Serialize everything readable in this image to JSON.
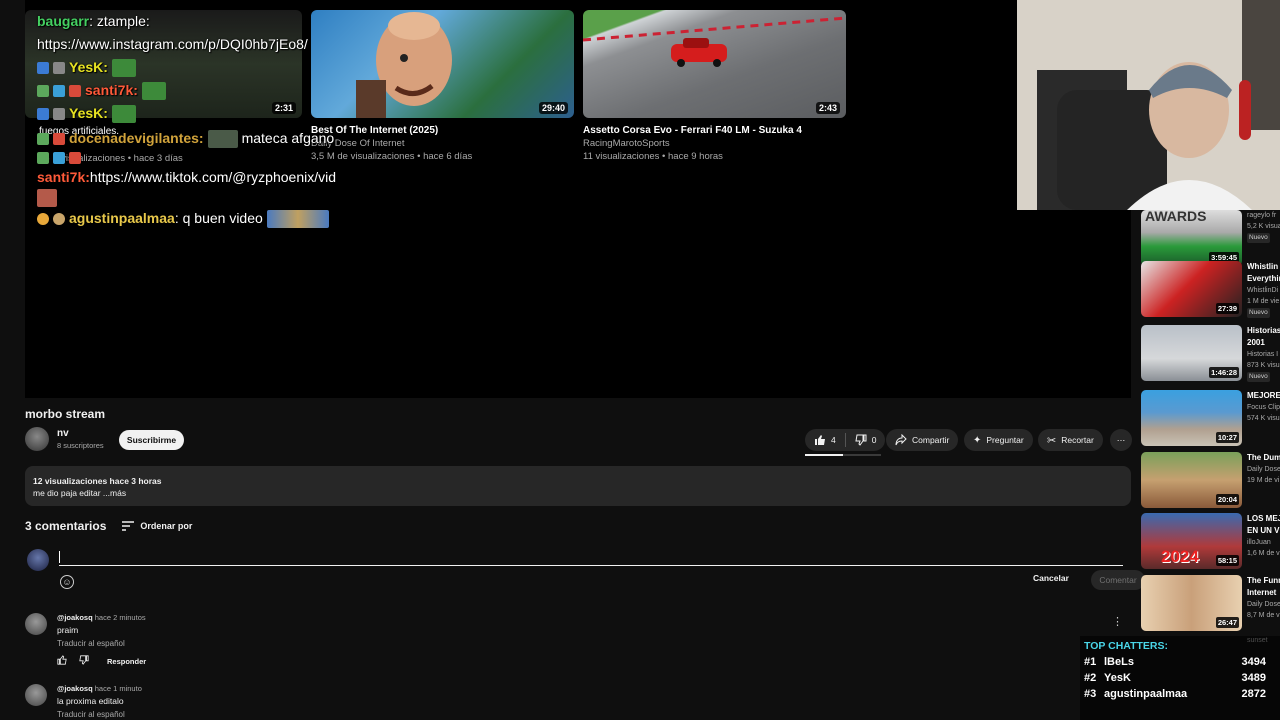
{
  "endscreen": [
    {
      "duration": "2:31",
      "title": "fuegos artificiales.",
      "meta": "36 K visualizaciones • hace 3 días"
    },
    {
      "duration": "29:40",
      "title": "Best Of The Internet (2025)",
      "channel": "Daily Dose Of Internet",
      "meta": "3,5 M de visualizaciones • hace 6 días"
    },
    {
      "duration": "2:43",
      "title": "Assetto Corsa Evo - Ferrari F40 LM - Suzuka 4",
      "channel": "RacingMarotoSports",
      "meta": "11 visualizaciones • hace 9 horas"
    }
  ],
  "chat": {
    "m1_user": "baugarr",
    "m1_text": ": ztample:",
    "m1_link": "https://www.instagram.com/p/DQI0hb7jEo8/",
    "m2_user": "YesK:",
    "m3_user": "santi7k:",
    "m4_user": "YesK:",
    "m5_user": "docenadevigilantes:",
    "m5_text": "mateca afgano",
    "m6_user": "santi7k:",
    "m6_text": " https://www.tiktok.com/@ryzphoenix/vid",
    "m7_user": "agustinpaalmaa",
    "m7_text": ": q buen video"
  },
  "video": {
    "title": "morbo stream",
    "channel_name": "nv",
    "subscribers": "8 suscriptores",
    "subscribe_label": "Suscribirme",
    "likes": "4",
    "dislikes": "0",
    "share_label": "Compartir",
    "ask_label": "Preguntar",
    "clip_label": "Recortar",
    "more_icon": "⋯",
    "stats": "12 visualizaciones  hace 3 horas",
    "description": "me dio paja editar ...más"
  },
  "comments": {
    "count_label": "3 comentarios",
    "sort_label": "Ordenar por",
    "cancel_label": "Cancelar",
    "comment_label": "Comentar",
    "items": [
      {
        "author": "@joakosq",
        "time": "hace 2 minutos",
        "text": "praim",
        "translate": "Traducir al español",
        "reply": "Responder"
      },
      {
        "author": "@joakosq",
        "time": "hace 1 minuto",
        "text": "la proxima editalo",
        "translate": "Traducir al español"
      }
    ]
  },
  "sidebar": [
    {
      "duration": "3:59:45",
      "title": "",
      "channel": "rageylo fr",
      "views": "5,2 K visua",
      "badge": "Nuevo",
      "overlay": "AWARDS"
    },
    {
      "duration": "27:39",
      "title": "Whistlin Everythin",
      "channel": "WhistlinDi",
      "views": "1 M de vie",
      "badge": "Nuevo"
    },
    {
      "duration": "1:46:28",
      "title": "Historias 2001",
      "channel": "Historias I",
      "views": "873 K visu",
      "badge": "Nuevo"
    },
    {
      "duration": "10:27",
      "title": "MEJORE",
      "channel": "Focus Clip",
      "views": "574 K visu"
    },
    {
      "duration": "20:04",
      "title": "The Dum",
      "channel": "Daily Dose",
      "views": "19 M de vi"
    },
    {
      "duration": "58:15",
      "title": "LOS MEJ EN UN V",
      "channel": "illoJuan",
      "views": "1,6 M de v",
      "overlay": "2024"
    },
    {
      "duration": "26:47",
      "title": "The Funn Internet",
      "channel": "Daily Dose",
      "views": "8,7 M de v"
    }
  ],
  "sidebar_extra": {
    "channel": "sunset"
  },
  "top_chatters": {
    "title": "TOP CHATTERS:",
    "rows": [
      {
        "rank": "#1",
        "name": "lBeLs",
        "count": "3494"
      },
      {
        "rank": "#2",
        "name": "YesK",
        "count": "3489"
      },
      {
        "rank": "#3",
        "name": "agustinpaalmaa",
        "count": "2872"
      }
    ]
  },
  "colors": {
    "bg": "#0f0f0f",
    "pill": "#272727",
    "accent_chat": "#4ad6e8"
  }
}
